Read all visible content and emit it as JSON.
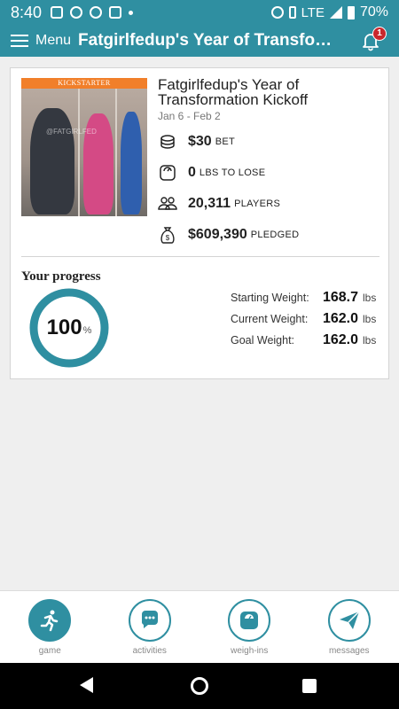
{
  "status_bar": {
    "time": "8:40",
    "network": "LTE",
    "battery": "70%"
  },
  "app_bar": {
    "menu_label": "Menu",
    "title": "Fatgirlfedup's Year of Transformation Kickoff",
    "notification_count": "1"
  },
  "game": {
    "banner": "KICKSTARTER",
    "watermark": "@FATGIRLFED",
    "title": "Fatgirlfedup's Year of Transformation Kickoff",
    "dates": "Jan 6 - Feb 2",
    "stats": [
      {
        "icon": "coins-icon",
        "value": "$30",
        "label": "BET"
      },
      {
        "icon": "scale-icon",
        "value": "0",
        "label": "LBS TO LOSE"
      },
      {
        "icon": "players-icon",
        "value": "20,311",
        "label": "PLAYERS"
      },
      {
        "icon": "money-bag-icon",
        "value": "$609,390",
        "label": "PLEDGED"
      }
    ]
  },
  "progress": {
    "title": "Your progress",
    "percent": 100,
    "percent_text": "100",
    "percent_unit": "%",
    "starting_label": "Starting Weight:",
    "starting_value": "168.7",
    "current_label": "Current Weight:",
    "current_value": "162.0",
    "goal_label": "Goal Weight:",
    "goal_value": "162.0",
    "unit": "lbs"
  },
  "bottom_nav": [
    {
      "label": "game",
      "icon": "runner-icon",
      "active": true
    },
    {
      "label": "activities",
      "icon": "chat-bubble-icon",
      "active": false
    },
    {
      "label": "weigh-ins",
      "icon": "weigh-in-scale-icon",
      "active": false
    },
    {
      "label": "messages",
      "icon": "paper-plane-icon",
      "active": false
    }
  ],
  "colors": {
    "brand": "#2f8fa1",
    "badge": "#c9272d",
    "banner": "#f17f2a"
  }
}
